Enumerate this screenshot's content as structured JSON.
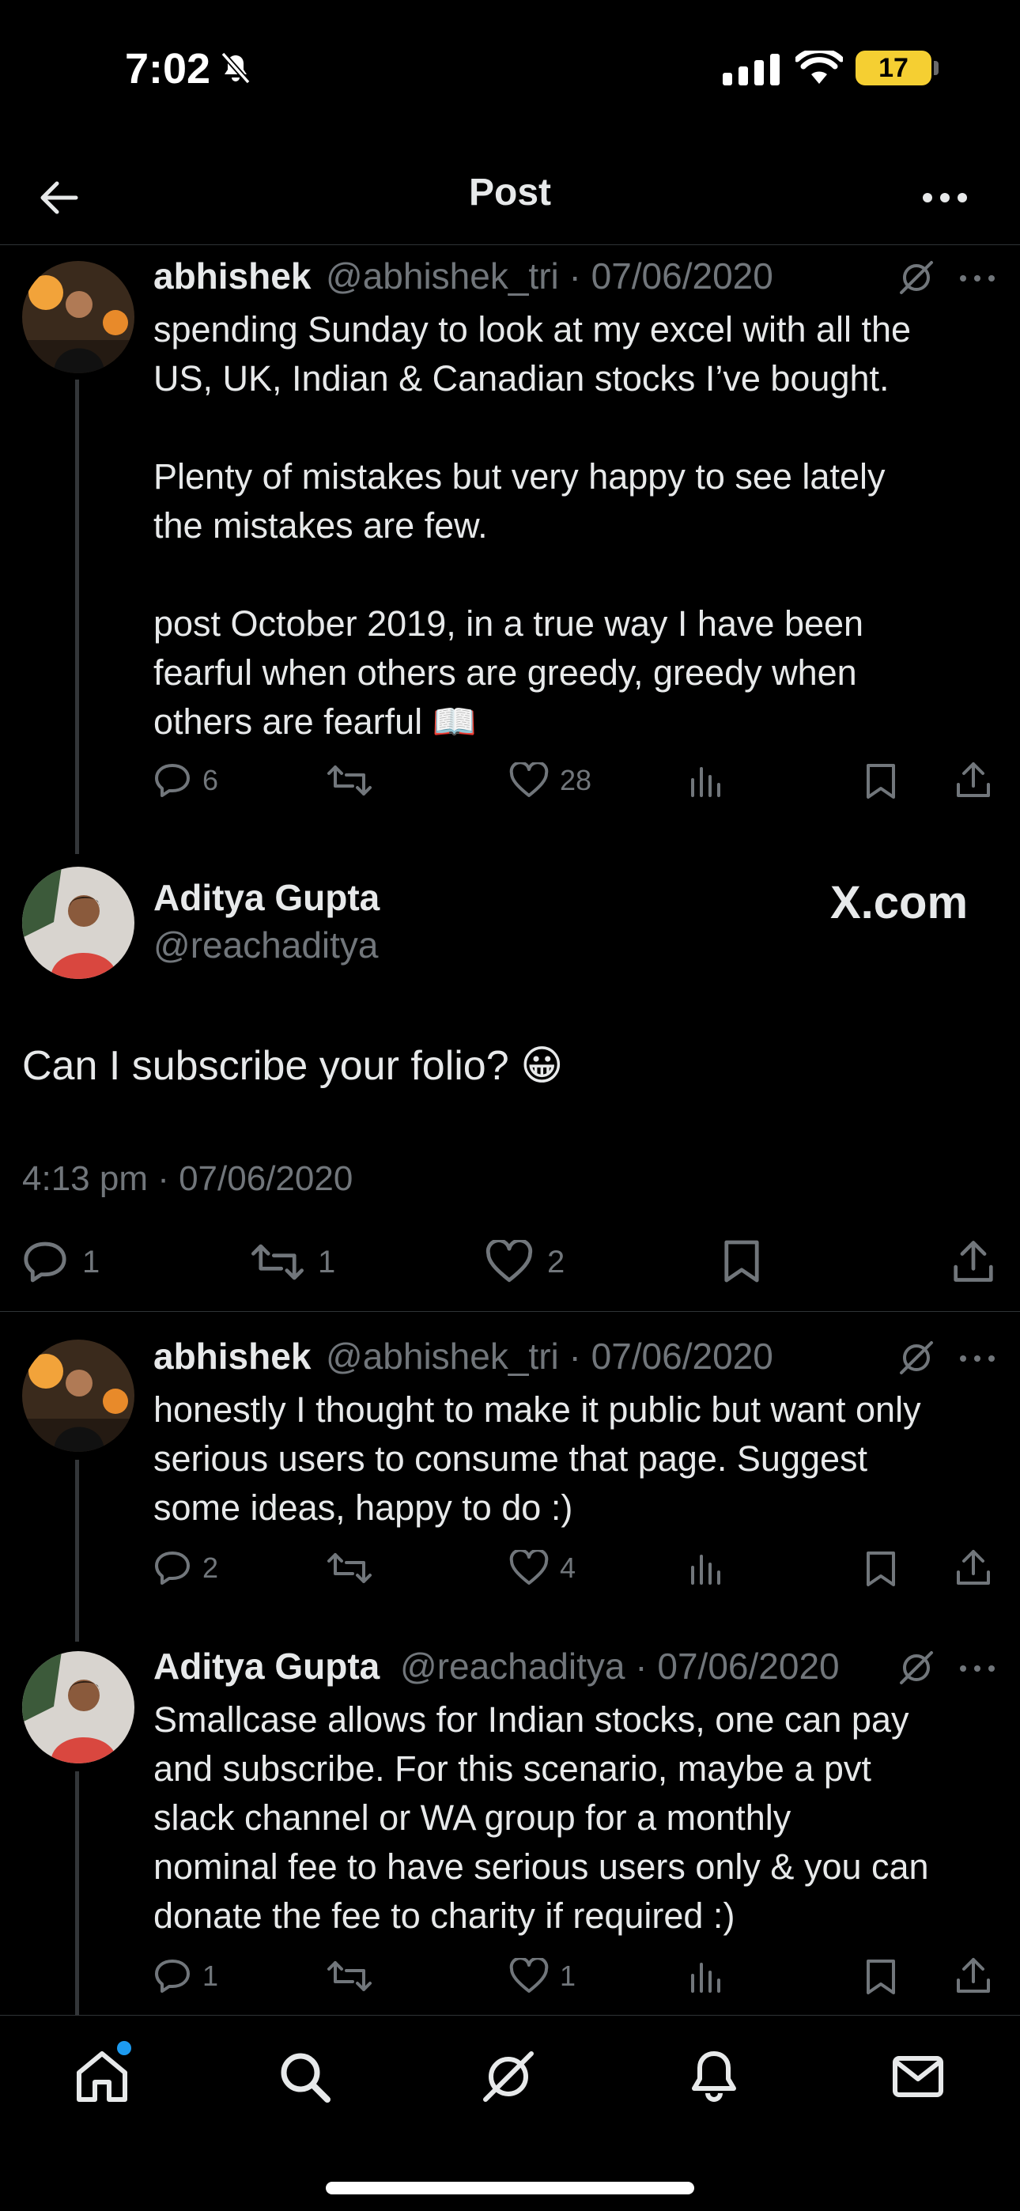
{
  "status_bar": {
    "time": "7:02",
    "battery": "17"
  },
  "header": {
    "title": "Post"
  },
  "tweets": [
    {
      "name": "abhishek",
      "meta": "@abhishek_tri · 07/06/2020",
      "text": "spending Sunday to look at my excel with all the\nUS, UK, Indian & Canadian stocks I’ve bought.\n\nPlenty of mistakes but very happy to see lately\nthe mistakes are few.\n\npost October 2019, in a true way I have been\nfearful when others are greedy, greedy when\nothers are fearful 📖",
      "replies": "6",
      "reposts": "",
      "likes": "28"
    },
    {
      "name": "abhishek",
      "meta": "@abhishek_tri · 07/06/2020",
      "text": "honestly I thought to make it public but want only\nserious users to consume that page. Suggest\nsome ideas, happy to do :)",
      "replies": "2",
      "reposts": "",
      "likes": "4"
    },
    {
      "name": "Aditya Gupta",
      "meta": "@reachaditya · 07/06/2020",
      "text": "Smallcase allows for Indian stocks, one can pay\nand subscribe. For this scenario, maybe a pvt\nslack channel or WA group for a monthly\nnominal fee to have serious users only & you can\ndonate the fee to charity if required :)",
      "replies": "1",
      "reposts": "",
      "likes": "1"
    }
  ],
  "main_post": {
    "name": "Aditya Gupta",
    "handle": "@reachaditya",
    "badge": "X.com",
    "text": "Can I subscribe your folio? 😀",
    "timestamp": "4:13 pm · 07/06/2020",
    "replies": "1",
    "reposts": "1",
    "likes": "2"
  },
  "icons": {
    "reply": "reply-icon",
    "repost": "repost-icon",
    "like": "heart-icon",
    "views": "views-icon",
    "bookmark": "bookmark-icon",
    "share": "share-icon"
  },
  "colors": {
    "accent": "#1d9bf0",
    "muted": "#71767b",
    "battery": "#f5cf32"
  }
}
